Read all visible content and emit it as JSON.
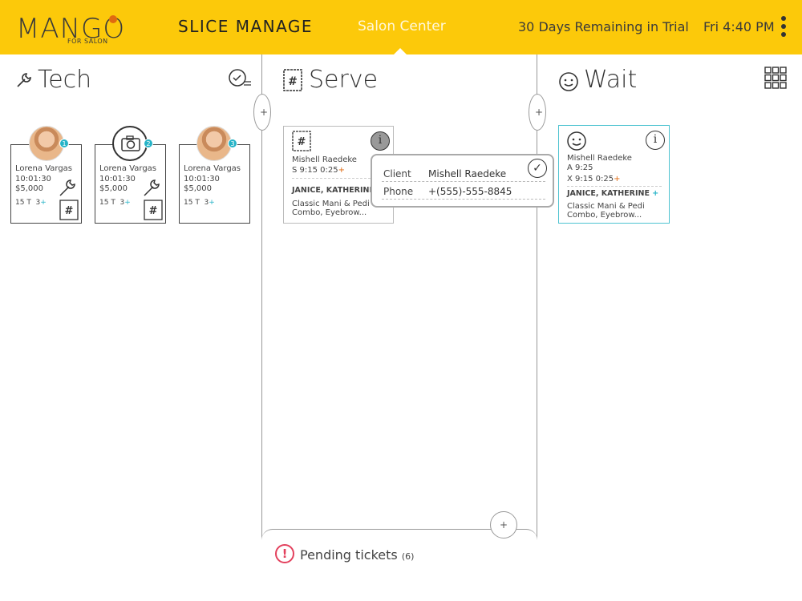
{
  "header": {
    "logo_word": "MANGO",
    "logo_sub": "FOR SALON",
    "nav_primary": "SLICE MANAGE",
    "nav_secondary": "Salon Center",
    "trial": "30 Days Remaining in Trial",
    "clock": "Fri 4:40 PM"
  },
  "columns": {
    "tech": "Tech",
    "serve": "Serve",
    "wait": "Wait"
  },
  "tech_cards": [
    {
      "name": "Lorena Vargas",
      "time": "10:01:30",
      "money": "$5,000",
      "turns": "15 T",
      "extra": "3",
      "badge": "1"
    },
    {
      "name": "Lorena Vargas",
      "time": "10:01:30",
      "money": "$5,000",
      "turns": "15 T",
      "extra": "3",
      "badge": "2"
    },
    {
      "name": "Lorena Vargas",
      "time": "10:01:30",
      "money": "$5,000",
      "turns": "15 T",
      "extra": "3",
      "badge": "3"
    }
  ],
  "serve_ticket": {
    "client": "Mishell Raedeke",
    "times": "S 9:15  0:25",
    "tech": "JANICE, KATHERINE",
    "service_1": "Classic Mani & Pedi",
    "service_2": "Combo, Eyebrow..."
  },
  "popup": {
    "client_label": "Client",
    "client_value": "Mishell Raedeke",
    "phone_label": "Phone",
    "phone_value": "+(555)-555-8845"
  },
  "wait_ticket": {
    "client": "Mishell Raedeke",
    "arrived": "A 9:25",
    "times": "X 9:15  0:25",
    "tech": "JANICE, KATHERINE",
    "service_1": "Classic Mani & Pedi",
    "service_2": "Combo, Eyebrow..."
  },
  "pending": {
    "label": "Pending tickets",
    "count": "(6)"
  },
  "colors": {
    "brand_yellow": "#fcc90a",
    "accent_teal": "#25b3c7",
    "accent_orange": "#e06a10",
    "alert_red": "#e3415d"
  }
}
